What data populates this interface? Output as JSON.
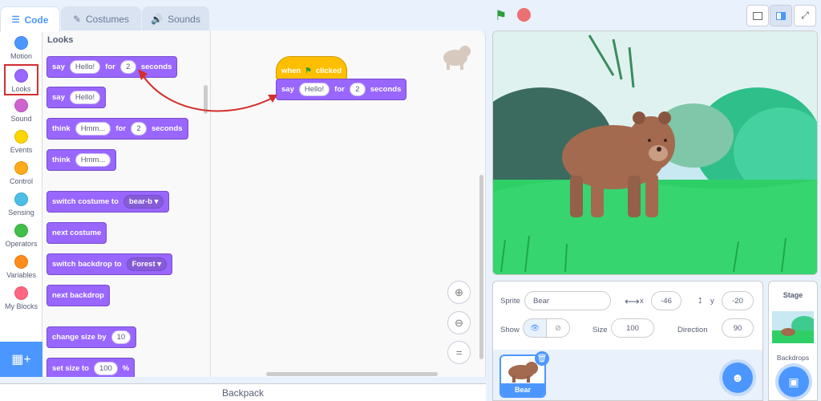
{
  "tabs": [
    {
      "label": "Code",
      "icon": "code-icon"
    },
    {
      "label": "Costumes",
      "icon": "brush-icon"
    },
    {
      "label": "Sounds",
      "icon": "speaker-icon"
    }
  ],
  "categories": [
    {
      "label": "Motion",
      "color": "#4c97ff"
    },
    {
      "label": "Looks",
      "color": "#9966ff",
      "selected": true
    },
    {
      "label": "Sound",
      "color": "#cf63cf"
    },
    {
      "label": "Events",
      "color": "#ffd500"
    },
    {
      "label": "Control",
      "color": "#ffab19"
    },
    {
      "label": "Sensing",
      "color": "#4cbfe6"
    },
    {
      "label": "Operators",
      "color": "#40bf4a"
    },
    {
      "label": "Variables",
      "color": "#ff8c1a"
    },
    {
      "label": "My Blocks",
      "color": "#ff6680"
    }
  ],
  "palette": {
    "title": "Looks",
    "b1": {
      "a": "say",
      "v": "Hello!",
      "b": "for",
      "n": "2",
      "c": "seconds"
    },
    "b2": {
      "a": "say",
      "v": "Hello!"
    },
    "b3": {
      "a": "think",
      "v": "Hmm...",
      "b": "for",
      "n": "2",
      "c": "seconds"
    },
    "b4": {
      "a": "think",
      "v": "Hmm..."
    },
    "b5": {
      "a": "switch costume to",
      "v": "bear-b"
    },
    "b6": {
      "a": "next costume"
    },
    "b7": {
      "a": "switch backdrop to",
      "v": "Forest"
    },
    "b8": {
      "a": "next backdrop"
    },
    "b9": {
      "a": "change size by",
      "n": "10"
    },
    "b10": {
      "a": "set size to",
      "n": "100",
      "c": "%"
    }
  },
  "script": {
    "when": "when",
    "clicked": "clicked",
    "say": "say",
    "v": "Hello!",
    "for": "for",
    "n": "2",
    "sec": "seconds"
  },
  "backpack": "Backpack",
  "sprite": {
    "label": "Sprite",
    "name": "Bear",
    "x_label": "x",
    "x": "-46",
    "y_label": "y",
    "y": "-20",
    "show": "Show",
    "size_label": "Size",
    "size": "100",
    "dir_label": "Direction",
    "dir": "90"
  },
  "sprite_thumb": "Bear",
  "stage_panel": {
    "title": "Stage",
    "backdrops": "Backdrops"
  }
}
